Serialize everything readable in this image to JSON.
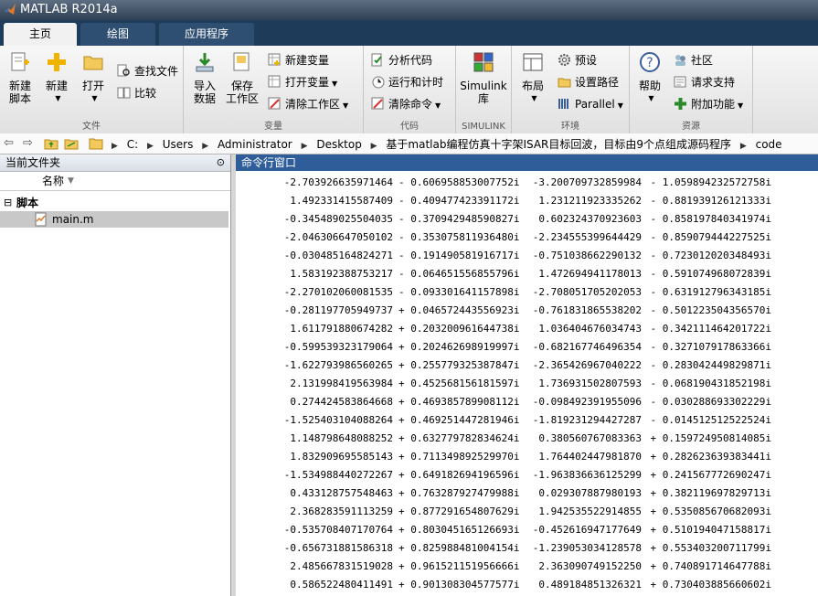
{
  "window": {
    "title": "MATLAB R2014a"
  },
  "tabs": [
    {
      "label": "主页",
      "active": true
    },
    {
      "label": "绘图",
      "active": false
    },
    {
      "label": "应用程序",
      "active": false
    }
  ],
  "ribbon": {
    "file": {
      "label": "文件",
      "new_script": "新建\n脚本",
      "new": "新建",
      "open": "打开",
      "find_files": "查找文件",
      "compare": "比较"
    },
    "variable": {
      "label": "变量",
      "import_data": "导入\n数据",
      "save_workspace": "保存\n工作区",
      "new_variable": "新建变量",
      "open_variable": "打开变量",
      "clear_workspace": "清除工作区"
    },
    "code": {
      "label": "代码",
      "analyze_code": "分析代码",
      "run_and_time": "运行和计时",
      "clear_commands": "清除命令"
    },
    "simulink": {
      "label": "SIMULINK",
      "library": "Simulink\n库"
    },
    "environment": {
      "label": "环境",
      "layout": "布局",
      "preferences": "预设",
      "set_path": "设置路径",
      "parallel": "Parallel"
    },
    "resources": {
      "label": "资源",
      "help": "帮助",
      "community": "社区",
      "request_support": "请求支持",
      "add_ons": "附加功能"
    }
  },
  "address": {
    "crumbs": [
      "C:",
      "Users",
      "Administrator",
      "Desktop",
      "基于matlab编程仿真十字架ISAR目标回波，目标由9个点组成源码程序",
      "code"
    ]
  },
  "current_folder": {
    "title": "当前文件夹",
    "column": "名称",
    "group": "脚本",
    "file": "main.m"
  },
  "command_window": {
    "title": "命令行窗口",
    "rows": [
      [
        "-2.703926635971464 - 0.606958853007752i",
        "-3.200709732859984 - 1.059894232572758i"
      ],
      [
        "1.492331415587409 - 0.409477423391172i",
        "1.231211923335262 - 0.881939126121333i"
      ],
      [
        "-0.345489025504035 - 0.370942948590827i",
        "0.602324370923603 - 0.858197840341974i"
      ],
      [
        "-2.046306647050102 - 0.353075811936480i",
        "-2.234555399644429 - 0.859079444227525i"
      ],
      [
        "-0.030485164824271 - 0.191490581916717i",
        "-0.751038662290132 - 0.723012020348493i"
      ],
      [
        "1.583192388753217 - 0.064651556855796i",
        "1.472694941178013 - 0.591074968072839i"
      ],
      [
        "-2.270102060081535 - 0.093301641157898i",
        "-2.708051705202053 - 0.631912796343185i"
      ],
      [
        "-0.281197705949737 + 0.046572443556923i",
        "-0.761831865538202 - 0.501223504356570i"
      ],
      [
        "1.611791880674282 + 0.203200961644738i",
        "1.036404676034743 - 0.342111464201722i"
      ],
      [
        "-0.599539323179064 + 0.202462698919997i",
        "-0.682167746496354 - 0.327107917863366i"
      ],
      [
        "-1.622793986560265 + 0.255779325387847i",
        "-2.365426967040222 - 0.283042449829871i"
      ],
      [
        "2.131998419563984 + 0.452568156181597i",
        "1.736931502807593 - 0.068190431852198i"
      ],
      [
        "0.274424583864668 + 0.469385789908112i",
        "-0.098492391955096 - 0.030288693302229i"
      ],
      [
        "-1.525403104088264 + 0.469251447281946i",
        "-1.819231294427287 - 0.014512512522524i"
      ],
      [
        "1.148798648088252 + 0.632779782834624i",
        "0.380560767083363 + 0.159724950814085i"
      ],
      [
        "1.832909695585143 + 0.711349892529970i",
        "1.764402447981870 + 0.282623639383441i"
      ],
      [
        "-1.534988440272267 + 0.649182694196596i",
        "-1.963836636125299 + 0.241567772690247i"
      ],
      [
        "0.433128757548463 + 0.763287927479988i",
        "0.029307887980193 + 0.382119697829713i"
      ],
      [
        "2.368283591113259 + 0.877291654807629i",
        "1.942535522914855 + 0.535085670682093i"
      ],
      [
        "-0.535708407170764 + 0.803045165126693i",
        "-0.452616947177649 + 0.510194047158817i"
      ],
      [
        "-0.656731881586318 + 0.825988481004154i",
        "-1.239053034128578 + 0.553403200711799i"
      ],
      [
        "2.485667831519028 + 0.961521151956666i",
        "2.363090749152250 + 0.740891714647788i"
      ],
      [
        "0.586522480411491 + 0.901308304577577i",
        "0.489184851326321 + 0.730403885660602i"
      ]
    ]
  }
}
